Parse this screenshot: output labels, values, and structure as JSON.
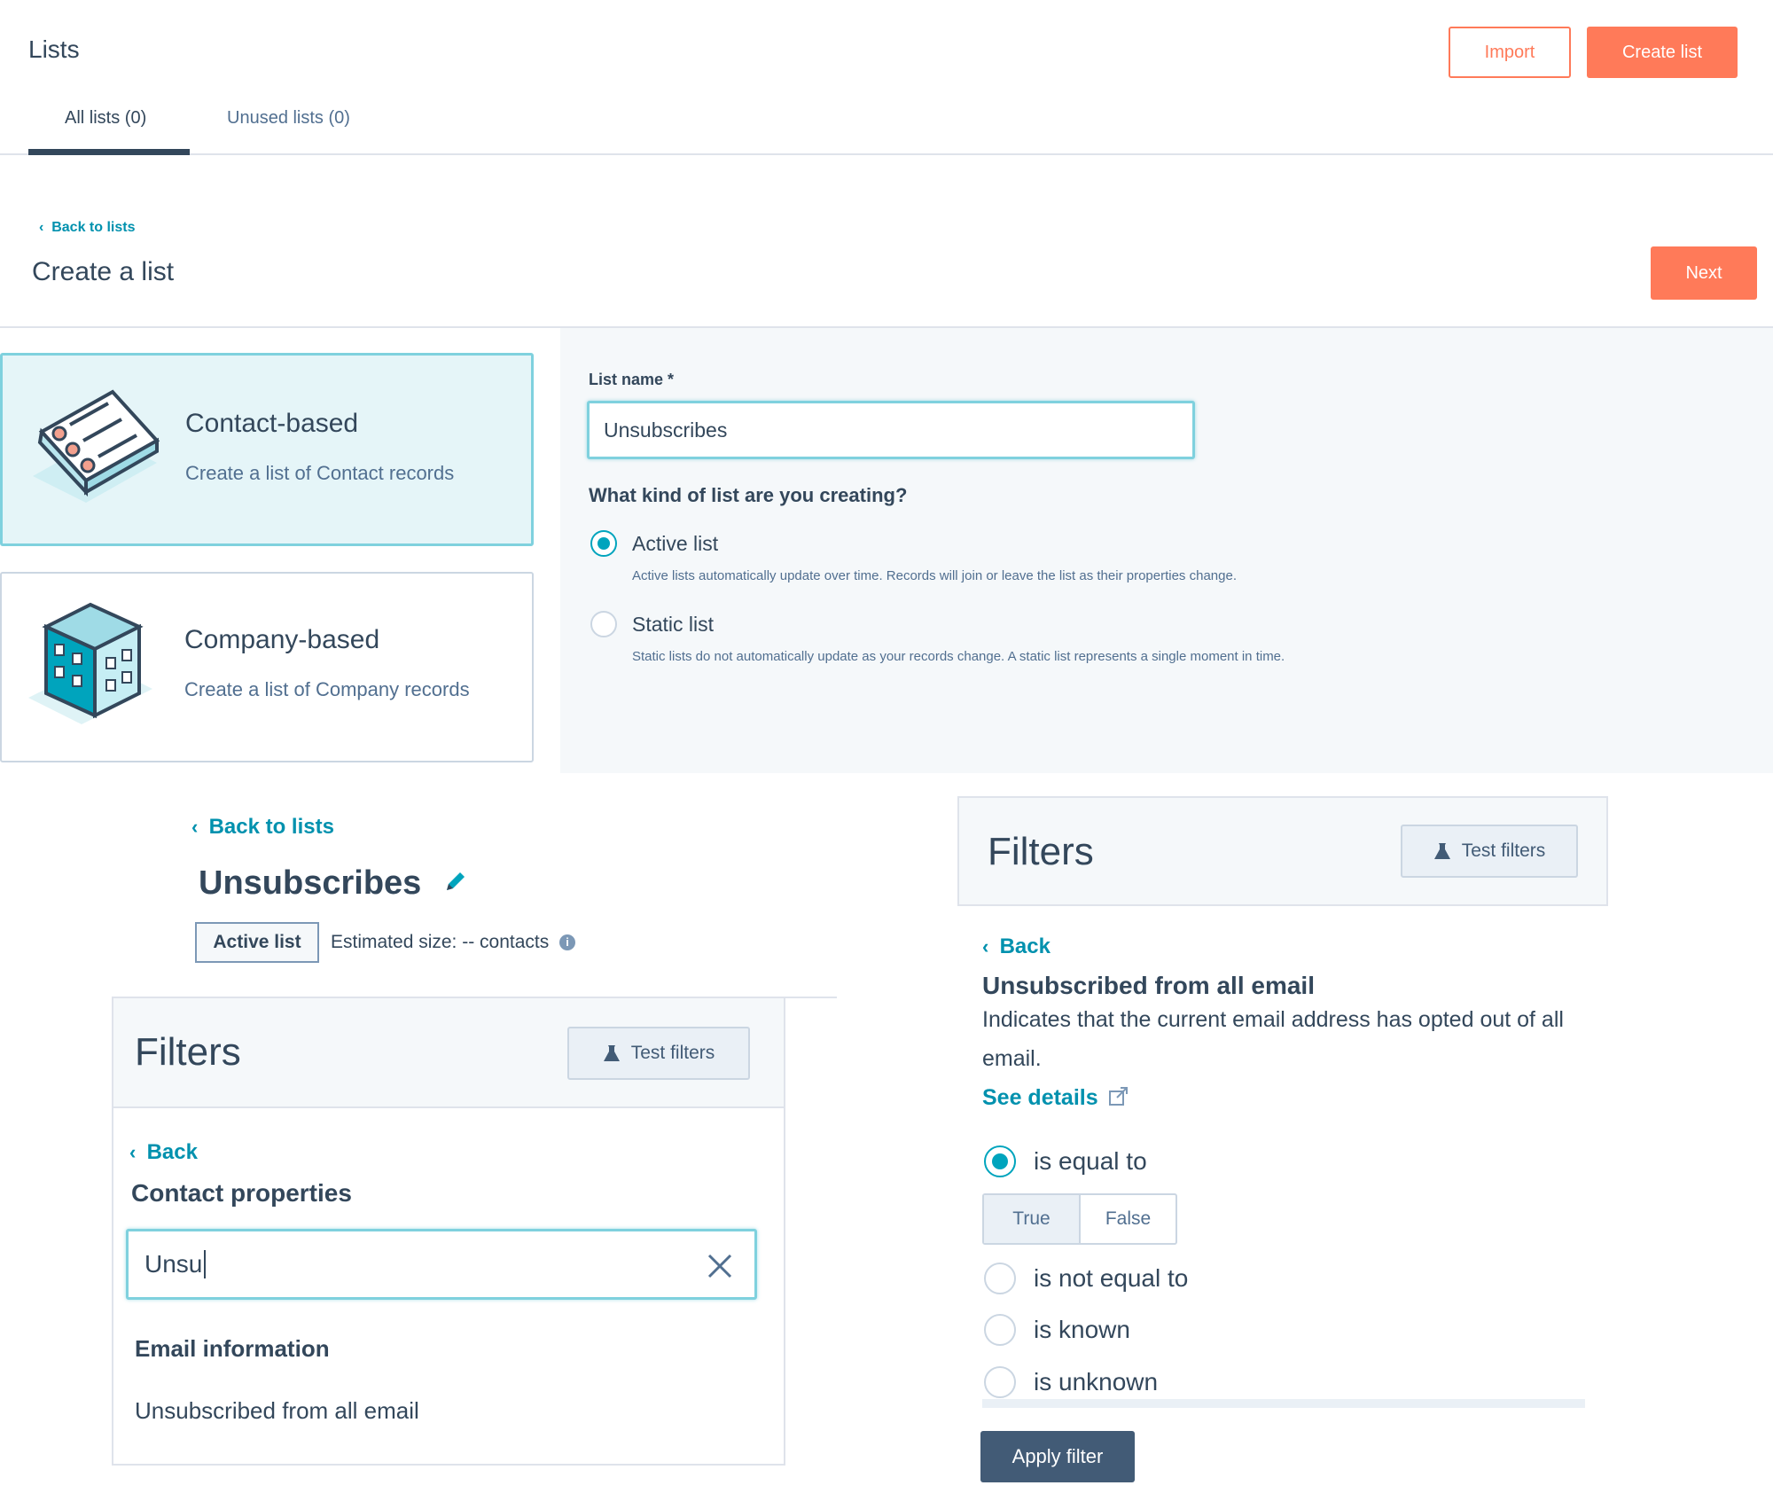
{
  "header": {
    "title": "Lists",
    "import_label": "Import",
    "create_label": "Create list",
    "tabs": [
      {
        "label": "All lists (0)"
      },
      {
        "label": "Unused lists (0)"
      }
    ]
  },
  "create": {
    "back_label": "Back to lists",
    "title": "Create a list",
    "next_label": "Next",
    "cards": [
      {
        "title": "Contact-based",
        "desc": "Create a list of Contact records"
      },
      {
        "title": "Company-based",
        "desc": "Create a list of Company records"
      }
    ],
    "list_name_label": "List name *",
    "list_name_value": "Unsubscribes",
    "question": "What kind of list are you creating?",
    "options": [
      {
        "label": "Active list",
        "help": "Active lists automatically update over time. Records will join or leave the list as their properties change."
      },
      {
        "label": "Static list",
        "help": "Static lists do not automatically update as your records change. A static list represents a single moment in time."
      }
    ]
  },
  "editor": {
    "back_label": "Back to lists",
    "list_name": "Unsubscribes",
    "badge": "Active list",
    "estimated_size": "Estimated size: -- contacts"
  },
  "filters_left": {
    "title": "Filters",
    "test_label": "Test filters",
    "back_label": "Back",
    "section": "Contact properties",
    "search_value": "Unsu",
    "group_heading": "Email information",
    "result_item": "Unsubscribed from all email"
  },
  "filters_right": {
    "title": "Filters",
    "test_label": "Test filters",
    "back_label": "Back",
    "property": "Unsubscribed from all email",
    "description": "Indicates that the current email address has opted out of all email.",
    "see_details": "See details",
    "operators": [
      {
        "label": "is equal to"
      },
      {
        "label": "is not equal to"
      },
      {
        "label": "is known"
      },
      {
        "label": "is unknown"
      }
    ],
    "bool_true": "True",
    "bool_false": "False",
    "apply_label": "Apply filter"
  },
  "colors": {
    "accent_orange": "#ff7a59",
    "accent_teal": "#00a4bd",
    "text_dark": "#33475b",
    "button_dark": "#425b76"
  }
}
